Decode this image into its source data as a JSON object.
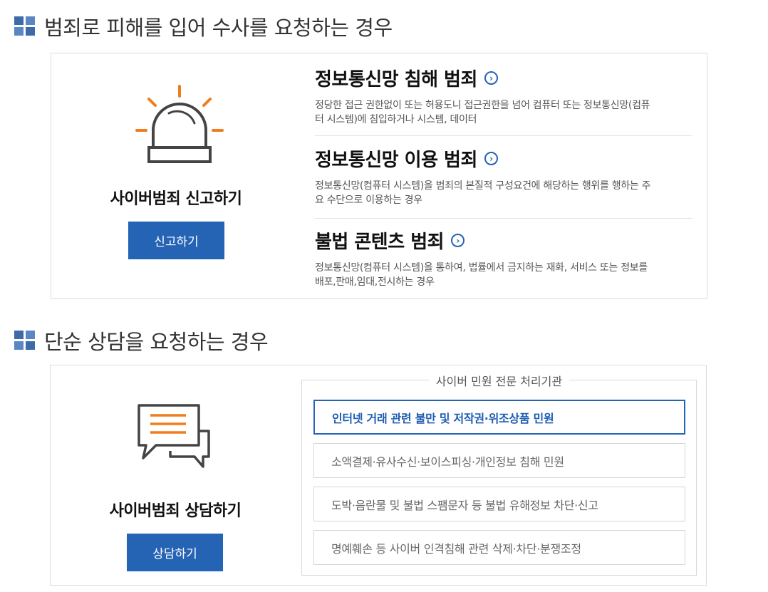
{
  "report_section": {
    "heading": "범죄로 피해를 입어 수사를 요청하는 경우",
    "left": {
      "title": "사이버범죄 신고하기",
      "button_label": "신고하기",
      "icon": "siren-icon"
    },
    "items": [
      {
        "title": "정보통신망 침해 범죄",
        "desc_line1": "정당한 접근 권한없이 또는 허용도니 접근권한을 넘어 컴퓨터 또는 정보통신망(컴퓨",
        "desc_line2": "터 시스템)에 침입하거나 시스템, 데이터"
      },
      {
        "title": "정보통신망 이용 범죄",
        "desc_line1": "정보통신망(컴퓨터 시스템)을 범죄의 본질적 구성요건에 해당하는 행위를 행하는 주",
        "desc_line2": "요 수단으로 이용하는 경우"
      },
      {
        "title": "불법 콘텐츠 범죄",
        "desc_line1": "정보통신망(컴퓨터 시스템)을 통하여, 법률에서 금지하는 재화, 서비스 또는 정보를",
        "desc_line2": "배포,판매,임대,전시하는 경우"
      }
    ]
  },
  "consult_section": {
    "heading": "단순 상담을 요청하는 경우",
    "left": {
      "title": "사이버범죄 상담하기",
      "button_label": "상담하기",
      "icon": "chat-bubbles-icon"
    },
    "agency_group_label": "사이버 민원 전문 처리기관",
    "options": [
      {
        "label": "인터넷 거래 관련 불만 및 저작권·위조상품 민원",
        "active": true
      },
      {
        "label": "소액결제·유사수신·보이스피싱·개인정보 침해 민원",
        "active": false
      },
      {
        "label": "도박·음란물 및 불법 스팸문자 등 불법 유해정보 차단·신고",
        "active": false
      },
      {
        "label": "명예훼손 등 사이버 인격침해 관련 삭제·차단·분쟁조정",
        "active": false
      }
    ]
  },
  "colors": {
    "accent": "#2563b5",
    "icon_orange": "#f07d1d",
    "icon_dark": "#444444"
  }
}
